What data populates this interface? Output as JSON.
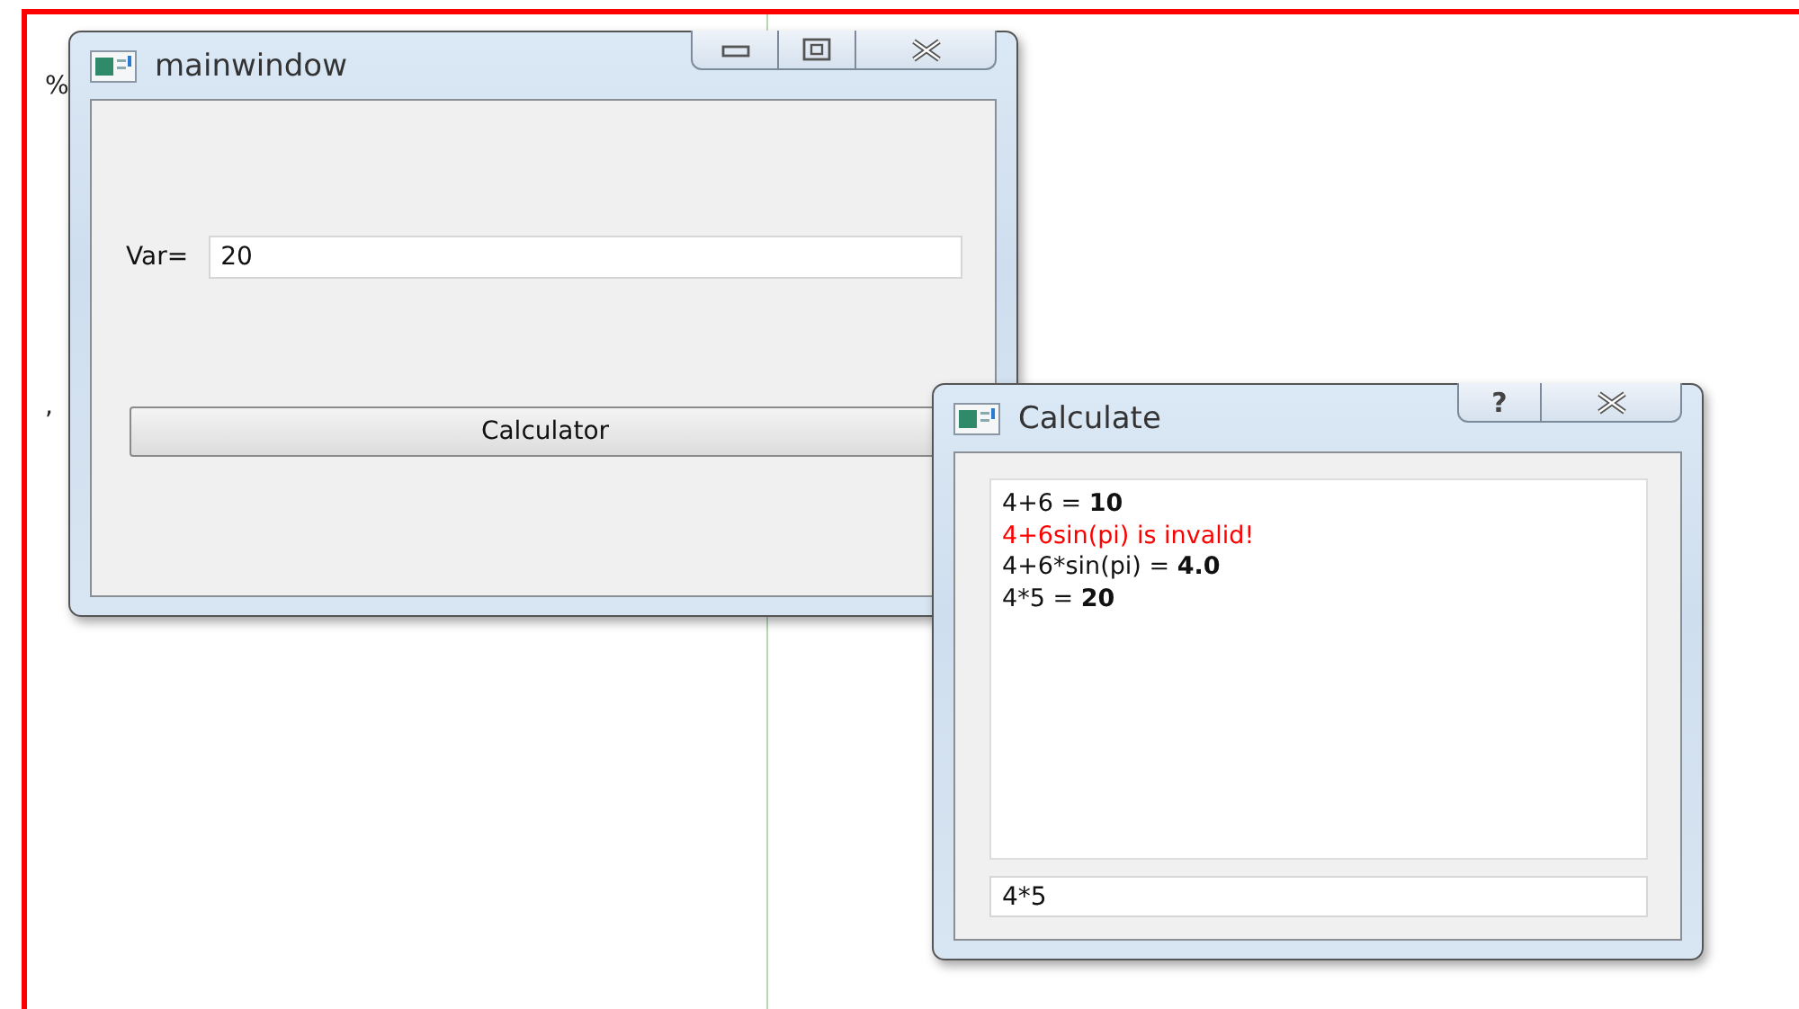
{
  "background_marks": [
    "%",
    ","
  ],
  "main_window": {
    "title": "mainwindow",
    "var_label": "Var=",
    "var_value": "20",
    "button": "Calculator"
  },
  "calc_window": {
    "title": "Calculate",
    "help_glyph": "?",
    "log": [
      {
        "kind": "result",
        "text": "4+6 = **10**"
      },
      {
        "kind": "error",
        "text": "4+6sin(pi) is invalid!"
      },
      {
        "kind": "result",
        "text": "4+6*sin(pi) = **4.0**"
      },
      {
        "kind": "result",
        "text": "4*5 = **20**"
      }
    ],
    "input_value": "4*5"
  }
}
